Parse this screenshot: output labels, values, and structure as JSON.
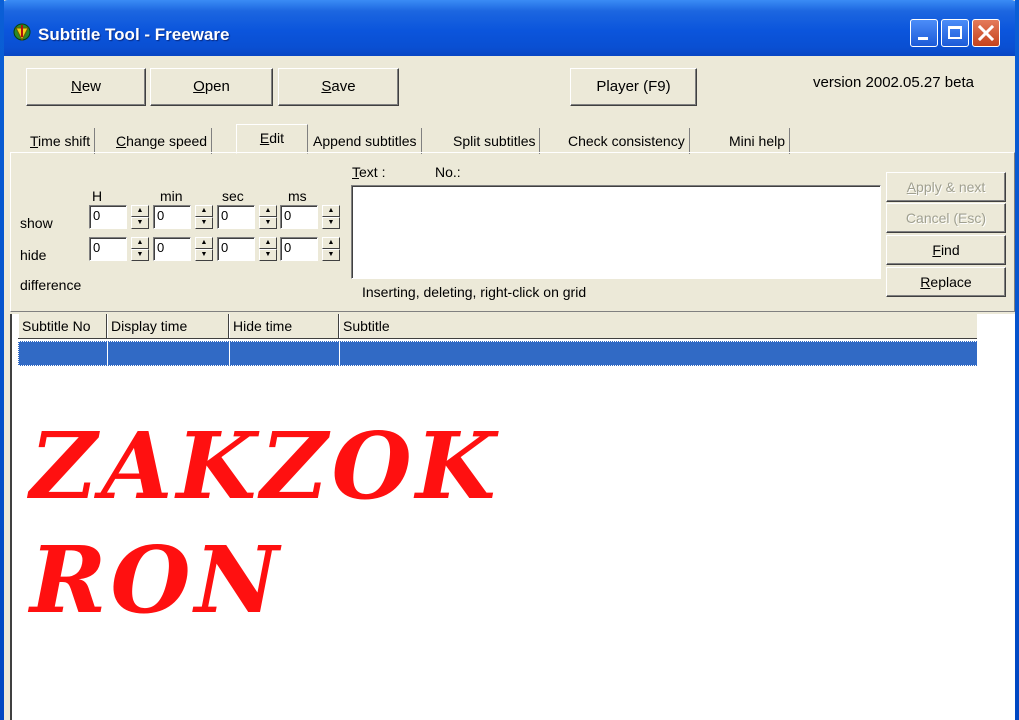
{
  "window": {
    "title": "Subtitle Tool - Freeware"
  },
  "toolbar": {
    "new_label": "New",
    "new_key": "N",
    "new_rest": "ew",
    "open_key": "O",
    "open_rest": "pen",
    "save_key": "S",
    "save_rest": "ave",
    "player_label": "Player (F9)",
    "version": "version  2002.05.27 beta"
  },
  "tabs": {
    "time_shift_key": "T",
    "time_shift_rest": "ime shift",
    "change_speed_key": "C",
    "change_speed_rest": "hange speed",
    "edit_key": "E",
    "edit_rest": "dit",
    "append": "Append subtitles",
    "split": "Split subtitles",
    "check": "Check consistency",
    "mini_help": "Mini help"
  },
  "edit": {
    "col_h": "H",
    "col_min": "min",
    "col_sec": "sec",
    "col_ms": "ms",
    "row_show": "show",
    "row_hide": "hide",
    "row_difference": "difference",
    "show_h": "0",
    "show_min": "0",
    "show_sec": "0",
    "show_ms": "0",
    "hide_h": "0",
    "hide_min": "0",
    "hide_sec": "0",
    "hide_ms": "0",
    "text_key": "T",
    "text_rest": "ext :",
    "no_label": "No.:",
    "hint": "Inserting, deleting, right-click on grid",
    "apply_key": "A",
    "apply_rest": "pply & next",
    "cancel_label": "Cancel (Esc)",
    "find_key": "F",
    "find_rest": "ind",
    "replace_key": "R",
    "replace_rest": "eplace"
  },
  "grid": {
    "columns": [
      "Subtitle No",
      "Display time",
      "Hide time",
      "Subtitle"
    ]
  },
  "overlay": {
    "line1": "ZAKZOK",
    "line2": "RON",
    "color": "#ff1010"
  },
  "colors": {
    "selection": "#316ac5",
    "titlebar": "#0b55dc",
    "face": "#ece9d8"
  }
}
